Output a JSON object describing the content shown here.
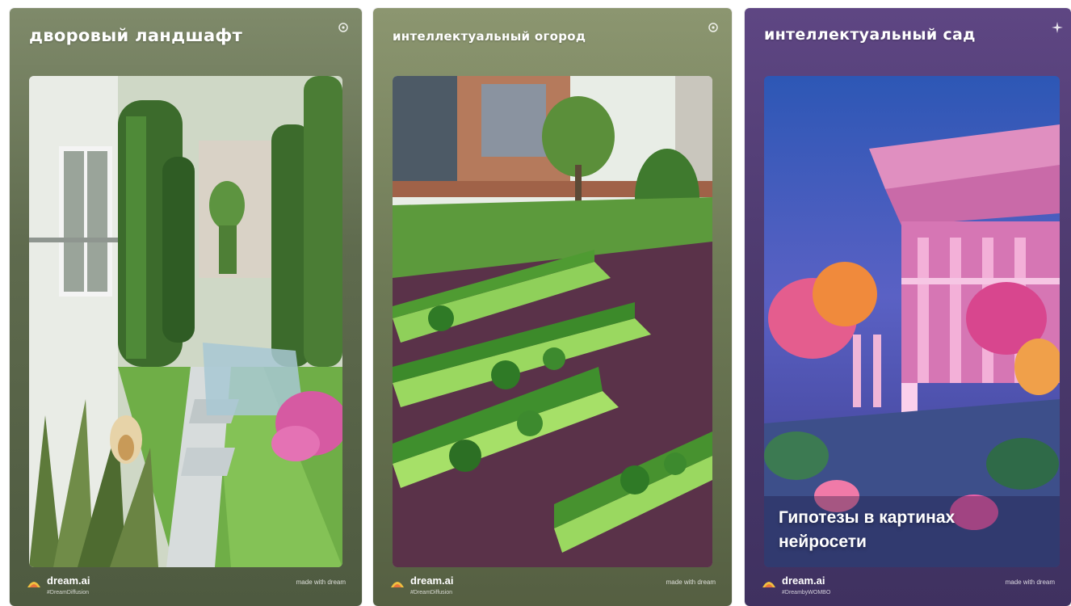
{
  "cards": [
    {
      "title": "дворовый ландшафт",
      "icon": "sparkle-icon",
      "brand": "dream.ai",
      "hashtag": "#DreamDiffusion",
      "made_with": "made with dream",
      "accent": "#6f7a5a"
    },
    {
      "title": "интеллектуальный огород",
      "icon": "sparkle-icon",
      "brand": "dream.ai",
      "hashtag": "#DreamDiffusion",
      "made_with": "made with dream",
      "accent": "#7a845e"
    },
    {
      "title": "интеллектуальный сад",
      "icon": "sparkle-icon",
      "brand": "dream.ai",
      "hashtag": "#DreambyWOMBO",
      "made_with": "made with dream",
      "accent": "#5a3f7a",
      "caption_lines": [
        "Гипотезы в картинах",
        "нейросети"
      ]
    }
  ]
}
